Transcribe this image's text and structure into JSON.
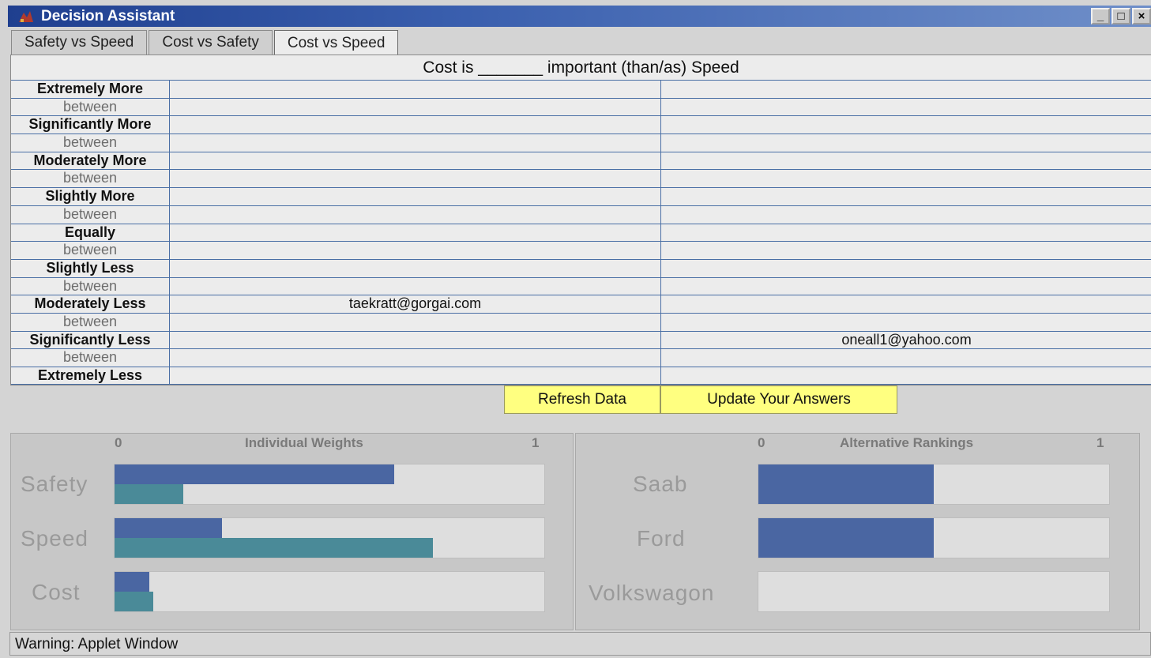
{
  "window": {
    "title": "Decision Assistant",
    "controls": {
      "minimize": "_",
      "maximize": "□",
      "close": "×"
    }
  },
  "tabs": [
    {
      "label": "Safety vs Speed",
      "active": false
    },
    {
      "label": "Cost vs Safety",
      "active": false
    },
    {
      "label": "Cost vs Speed",
      "active": true
    }
  ],
  "question": {
    "prefix": "Cost is ",
    "blank": "_______",
    "suffix": " important (than/as) Speed"
  },
  "grid": {
    "rows": [
      {
        "label": "Extremely More",
        "kind": "strong",
        "col_a": "",
        "col_b": ""
      },
      {
        "label": "between",
        "kind": "weak",
        "col_a": "",
        "col_b": ""
      },
      {
        "label": "Significantly More",
        "kind": "strong",
        "col_a": "",
        "col_b": ""
      },
      {
        "label": "between",
        "kind": "weak",
        "col_a": "",
        "col_b": ""
      },
      {
        "label": "Moderately More",
        "kind": "strong",
        "col_a": "",
        "col_b": ""
      },
      {
        "label": "between",
        "kind": "weak",
        "col_a": "",
        "col_b": ""
      },
      {
        "label": "Slightly More",
        "kind": "strong",
        "col_a": "",
        "col_b": ""
      },
      {
        "label": "between",
        "kind": "weak",
        "col_a": "",
        "col_b": ""
      },
      {
        "label": "Equally",
        "kind": "strong",
        "col_a": "",
        "col_b": ""
      },
      {
        "label": "between",
        "kind": "weak",
        "col_a": "",
        "col_b": ""
      },
      {
        "label": "Slightly Less",
        "kind": "strong",
        "col_a": "",
        "col_b": ""
      },
      {
        "label": "between",
        "kind": "weak",
        "col_a": "",
        "col_b": ""
      },
      {
        "label": "Moderately Less",
        "kind": "strong",
        "col_a": "taekratt@gorgai.com",
        "col_b": ""
      },
      {
        "label": "between",
        "kind": "weak",
        "col_a": "",
        "col_b": ""
      },
      {
        "label": "Significantly Less",
        "kind": "strong",
        "col_a": "",
        "col_b": "oneall1@yahoo.com"
      },
      {
        "label": "between",
        "kind": "weak",
        "col_a": "",
        "col_b": ""
      },
      {
        "label": "Extremely Less",
        "kind": "strong",
        "col_a": "",
        "col_b": ""
      }
    ]
  },
  "buttons": {
    "refresh": "Refresh Data",
    "update": "Update Your Answers"
  },
  "individual_weights": {
    "title": "Individual Weights",
    "axis_min": "0",
    "axis_max": "1",
    "items": [
      {
        "label": "Safety",
        "bar1": 0.65,
        "bar2": 0.16
      },
      {
        "label": "Speed",
        "bar1": 0.25,
        "bar2": 0.74
      },
      {
        "label": "Cost",
        "bar1": 0.08,
        "bar2": 0.09
      }
    ]
  },
  "alternative_rankings": {
    "title": "Alternative Rankings",
    "axis_min": "0",
    "axis_max": "1",
    "items": [
      {
        "label": "Saab",
        "value": 0.5
      },
      {
        "label": "Ford",
        "value": 0.5
      },
      {
        "label": "Volkswagon",
        "value": 0.0
      }
    ]
  },
  "status": {
    "text": "Warning: Applet Window"
  },
  "colors": {
    "bar_dark": "#4a66a2",
    "bar_teal": "#4a8a98",
    "button_yellow": "#ffff80",
    "grid_line": "#4a6fa5"
  }
}
